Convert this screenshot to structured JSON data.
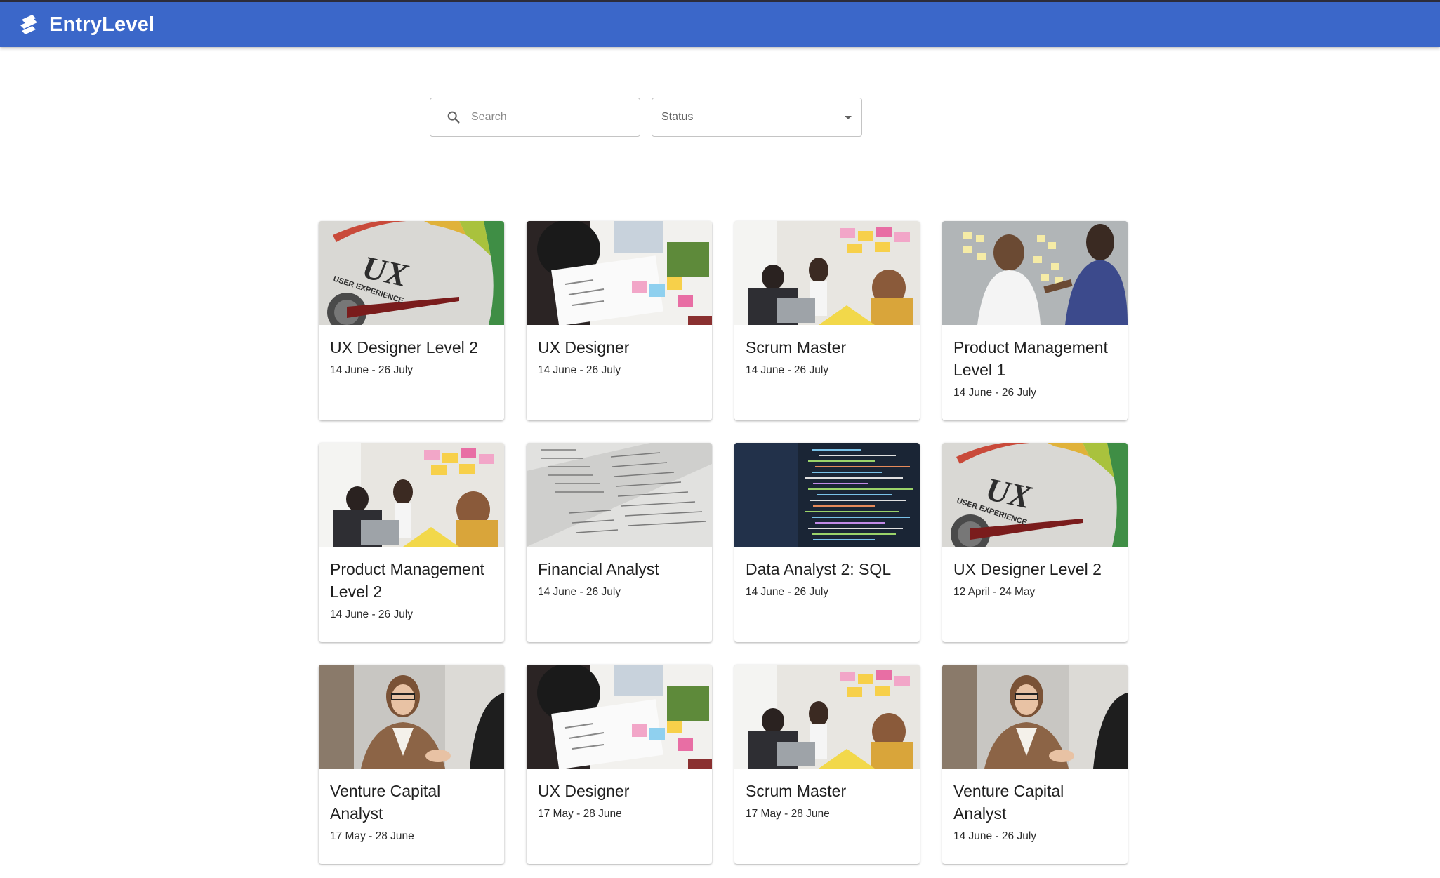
{
  "app": {
    "brand": "EntryLevel"
  },
  "filters": {
    "search_placeholder": "Search",
    "status_label": "Status"
  },
  "cards": [
    {
      "title": "UX Designer Level 2",
      "dates": "14 June - 26 July",
      "image": "ux-gauge"
    },
    {
      "title": "UX Designer",
      "dates": "14 June - 26 July",
      "image": "wireframe-desk"
    },
    {
      "title": "Scrum Master",
      "dates": "14 June - 26 July",
      "image": "team-meeting"
    },
    {
      "title": "Product Management Level 1",
      "dates": "14 June - 26 July",
      "image": "sticky-wall"
    },
    {
      "title": "Product Management Level 2",
      "dates": "14 June - 26 July",
      "image": "team-meeting"
    },
    {
      "title": "Financial Analyst",
      "dates": "14 June - 26 July",
      "image": "finance-papers"
    },
    {
      "title": "Data Analyst 2: SQL",
      "dates": "14 June - 26 July",
      "image": "code-screen"
    },
    {
      "title": "UX Designer Level 2",
      "dates": "12 April - 24 May",
      "image": "ux-gauge"
    },
    {
      "title": "Venture Capital Analyst",
      "dates": "17 May - 28 June",
      "image": "handshake"
    },
    {
      "title": "UX Designer",
      "dates": "17 May - 28 June",
      "image": "wireframe-desk"
    },
    {
      "title": "Scrum Master",
      "dates": "17 May - 28 June",
      "image": "team-meeting"
    },
    {
      "title": "Venture Capital Analyst",
      "dates": "14 June - 26 July",
      "image": "handshake"
    }
  ],
  "colors": {
    "header": "#3b67c9",
    "accent": "#3b67c9"
  }
}
